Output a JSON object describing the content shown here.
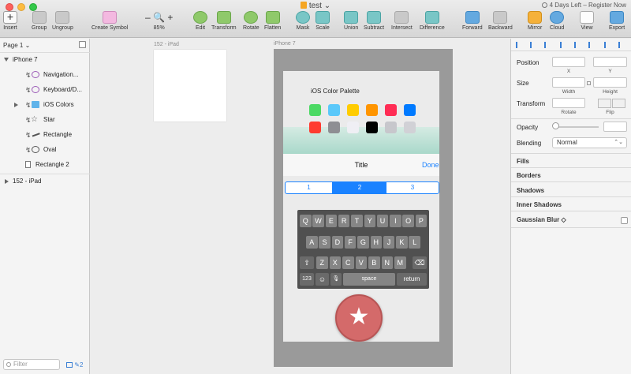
{
  "window": {
    "title": "test",
    "trial": "4 Days Left – Register Now"
  },
  "toolbar": {
    "insert": "Insert",
    "group": "Group",
    "ungroup": "Ungroup",
    "create_symbol": "Create Symbol",
    "zoom_minus": "–",
    "zoom_plus": "+",
    "zoom_level": "85%",
    "edit": "Edit",
    "transform": "Transform",
    "rotate": "Rotate",
    "flatten": "Flatten",
    "mask": "Mask",
    "scale": "Scale",
    "union": "Union",
    "subtract": "Subtract",
    "intersect": "Intersect",
    "difference": "Difference",
    "forward": "Forward",
    "backward": "Backward",
    "mirror": "Mirror",
    "cloud": "Cloud",
    "view": "View",
    "export": "Export"
  },
  "layers": {
    "page": "Page 1 ⌄",
    "items": [
      {
        "name": "iPhone 7"
      },
      {
        "name": "Navigation..."
      },
      {
        "name": "Keyboard/D..."
      },
      {
        "name": "iOS Colors"
      },
      {
        "name": "Star"
      },
      {
        "name": "Rectangle"
      },
      {
        "name": "Oval"
      },
      {
        "name": "Rectangle 2"
      },
      {
        "name": "152 - iPad"
      }
    ],
    "filter_placeholder": "Filter",
    "edit_count": "2"
  },
  "canvas": {
    "ipad_label": "152 - iPad",
    "iphone_label": "iPhone 7",
    "palette_title": "iOS Color Palette",
    "swatches_row1": [
      "#4cd964",
      "#5ac8fa",
      "#ffcc00",
      "#ff9500",
      "#ff2d55",
      "#007aff"
    ],
    "swatches_row2": [
      "#ff3b30",
      "#8e8e93",
      "#efeff4",
      "#000000",
      "#c7c7cc",
      "#d1d1d6"
    ],
    "nav_title": "Title",
    "nav_done": "Done",
    "segments": [
      "1",
      "2",
      "3"
    ],
    "keyboard": {
      "row1": [
        "Q",
        "W",
        "E",
        "R",
        "T",
        "Y",
        "U",
        "I",
        "O",
        "P"
      ],
      "row2": [
        "A",
        "S",
        "D",
        "F",
        "G",
        "H",
        "J",
        "K",
        "L"
      ],
      "row3": [
        "Z",
        "X",
        "C",
        "V",
        "B",
        "N",
        "M"
      ],
      "num": "123",
      "space": "space",
      "return": "return",
      "shift": "⇧",
      "delete": "⌫",
      "emoji": "☺",
      "mic": "🎙"
    },
    "fab_icon": "★"
  },
  "inspector": {
    "position": "Position",
    "x": "X",
    "y": "Y",
    "size": "Size",
    "width": "Width",
    "height": "Height",
    "transform": "Transform",
    "rotate": "Rotate",
    "flip": "Flip",
    "opacity": "Opacity",
    "blending": "Blending",
    "blending_value": "Normal",
    "fills": "Fills",
    "borders": "Borders",
    "shadows": "Shadows",
    "inner_shadows": "Inner Shadows",
    "gaussian_blur": "Gaussian Blur ◇"
  }
}
